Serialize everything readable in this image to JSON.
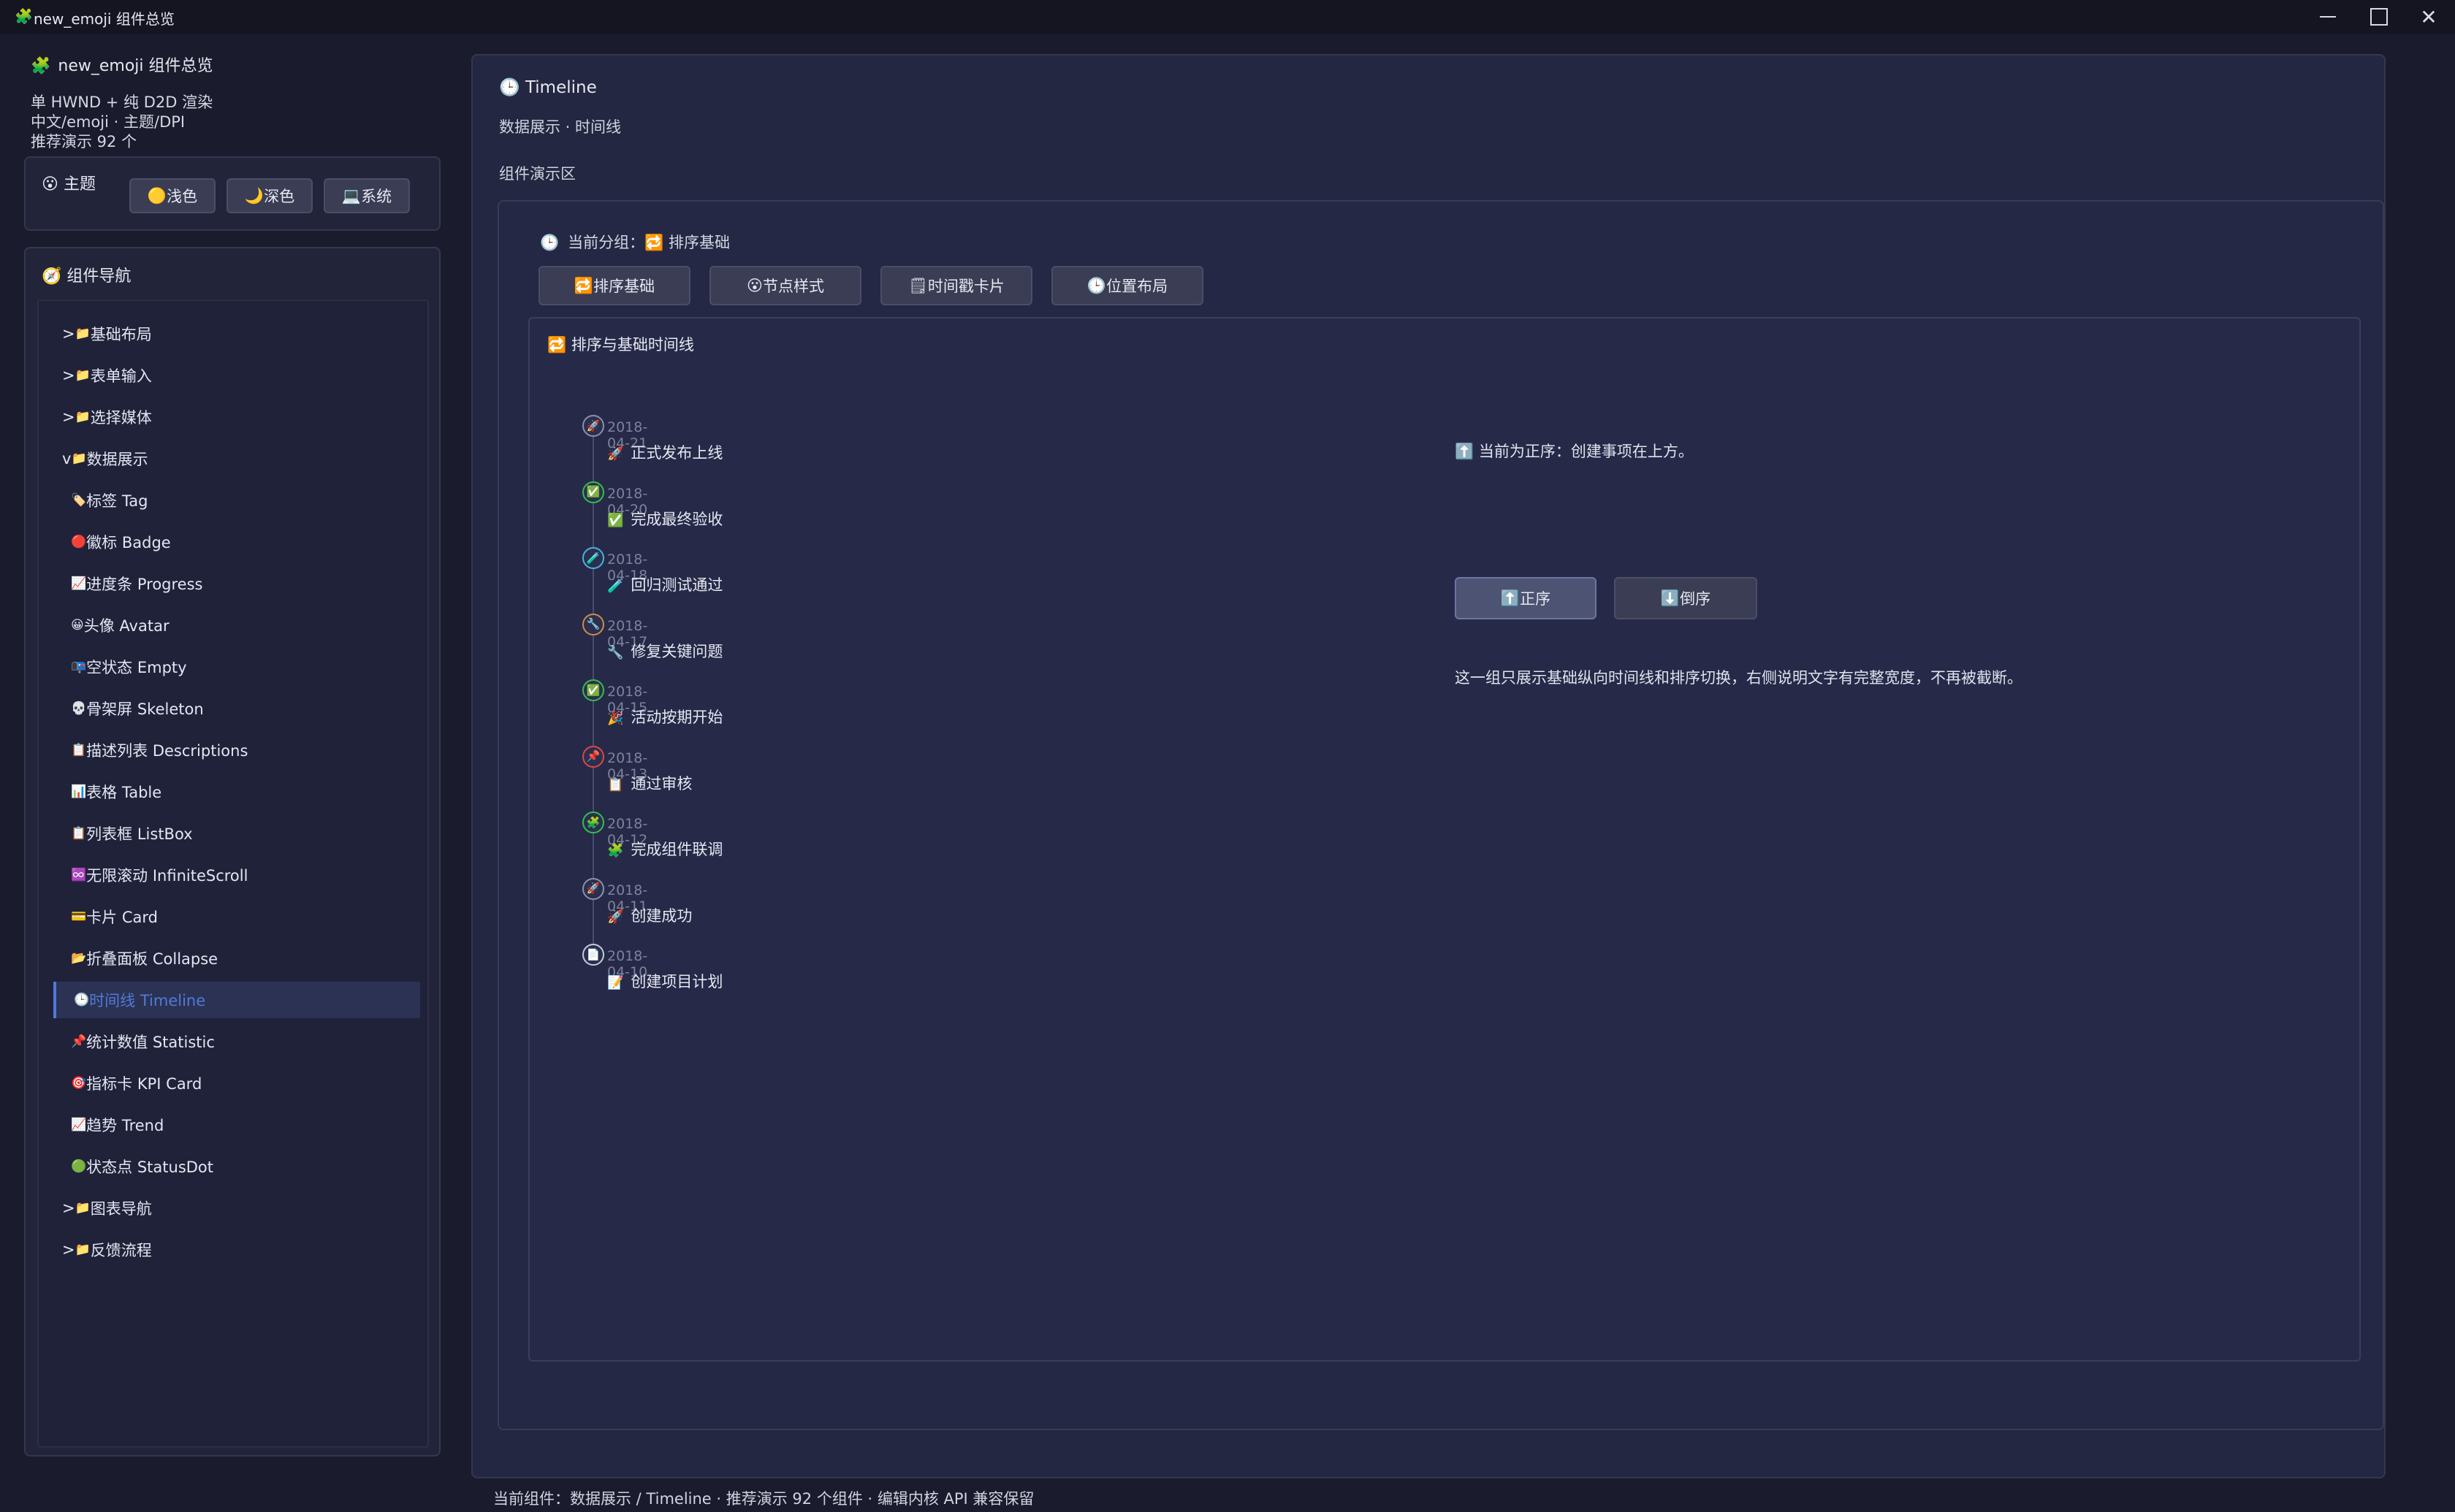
{
  "window": {
    "icon": "🧩",
    "title": "new_emoji 组件总览"
  },
  "sidebar": {
    "app_icon": "🧩",
    "app_title": "new_emoji 组件总览",
    "lines": [
      "单 HWND + 纯 D2D 渲染",
      "中文/emoji · 主题/DPI",
      "推荐演示 92 个"
    ],
    "theme": {
      "icon": "😮",
      "title": "主题",
      "buttons": [
        {
          "icon": "🟡",
          "label": "浅色"
        },
        {
          "icon": "🌙",
          "label": "深色"
        },
        {
          "icon": "💻",
          "label": "系统"
        }
      ]
    },
    "nav": {
      "icon": "🧭",
      "title": "组件导航",
      "items": [
        {
          "prefix": ">",
          "icon": "📁",
          "label": "基础布局",
          "child": false
        },
        {
          "prefix": ">",
          "icon": "📁",
          "label": "表单输入",
          "child": false
        },
        {
          "prefix": ">",
          "icon": "📁",
          "label": "选择媒体",
          "child": false
        },
        {
          "prefix": "v",
          "icon": "📁",
          "label": "数据展示",
          "child": false
        },
        {
          "prefix": "",
          "icon": "🏷️",
          "label": "标签 Tag",
          "child": true
        },
        {
          "prefix": "",
          "icon": "🔴",
          "label": "徽标 Badge",
          "child": true
        },
        {
          "prefix": "",
          "icon": "📈",
          "label": "进度条 Progress",
          "child": true
        },
        {
          "prefix": "",
          "icon": "😀",
          "label": "头像 Avatar",
          "child": true
        },
        {
          "prefix": "",
          "icon": "📭",
          "label": "空状态 Empty",
          "child": true
        },
        {
          "prefix": "",
          "icon": "💀",
          "label": "骨架屏 Skeleton",
          "child": true
        },
        {
          "prefix": "",
          "icon": "📋",
          "label": "描述列表 Descriptions",
          "child": true
        },
        {
          "prefix": "",
          "icon": "📊",
          "label": "表格 Table",
          "child": true
        },
        {
          "prefix": "",
          "icon": "📋",
          "label": "列表框 ListBox",
          "child": true
        },
        {
          "prefix": "",
          "icon": "♾️",
          "label": "无限滚动 InfiniteScroll",
          "child": true
        },
        {
          "prefix": "",
          "icon": "💳",
          "label": "卡片 Card",
          "child": true
        },
        {
          "prefix": "",
          "icon": "📂",
          "label": "折叠面板 Collapse",
          "child": true
        },
        {
          "prefix": "",
          "icon": "🕒",
          "label": "时间线 Timeline",
          "child": true,
          "active": true
        },
        {
          "prefix": "",
          "icon": "📌",
          "label": "统计数值 Statistic",
          "child": true
        },
        {
          "prefix": "",
          "icon": "🎯",
          "label": "指标卡 KPI Card",
          "child": true
        },
        {
          "prefix": "",
          "icon": "📈",
          "label": "趋势 Trend",
          "child": true
        },
        {
          "prefix": "",
          "icon": "🟢",
          "label": "状态点 StatusDot",
          "child": true
        },
        {
          "prefix": ">",
          "icon": "📁",
          "label": "图表导航",
          "child": false
        },
        {
          "prefix": ">",
          "icon": "📁",
          "label": "反馈流程",
          "child": false
        }
      ]
    }
  },
  "main": {
    "title_icon": "🕒",
    "title": "Timeline",
    "subtitle": "数据展示 · 时间线",
    "area_label": "组件演示区",
    "group": {
      "icon": "🕒",
      "label": "当前分组：",
      "value_icon": "🔁",
      "value": "排序基础"
    },
    "tabs": [
      {
        "icon": "🔁",
        "label": "排序基础"
      },
      {
        "icon": "😮",
        "label": "节点样式"
      },
      {
        "icon": "🗒",
        "label": "时间戳卡片"
      },
      {
        "icon": "🕒",
        "label": "位置布局"
      }
    ],
    "panel": {
      "icon": "🔁",
      "title": "排序与基础时间线"
    },
    "timeline": [
      {
        "node": "🚀",
        "color": "#8b90b0",
        "date": "2018-04-21",
        "icon": "🚀",
        "text": "正式发布上线"
      },
      {
        "node": "✅",
        "color": "#2fbf4f",
        "date": "2018-04-20",
        "icon": "✅",
        "text": "完成最终验收"
      },
      {
        "node": "🧪",
        "color": "#4ab3d8",
        "date": "2018-04-18",
        "icon": "🧪",
        "text": "回归测试通过"
      },
      {
        "node": "🔧",
        "color": "#d08a4a",
        "date": "2018-04-17",
        "icon": "🔧",
        "text": "修复关键问题"
      },
      {
        "node": "✅",
        "color": "#2fbf4f",
        "date": "2018-04-15",
        "icon": "🎉",
        "text": "活动按期开始"
      },
      {
        "node": "📌",
        "color": "#d94848",
        "date": "2018-04-13",
        "icon": "📋",
        "text": "通过审核"
      },
      {
        "node": "🧩",
        "color": "#2fbf4f",
        "date": "2018-04-12",
        "icon": "🧩",
        "text": "完成组件联调"
      },
      {
        "node": "🚀",
        "color": "#8b90b0",
        "date": "2018-04-11",
        "icon": "🚀",
        "text": "创建成功"
      },
      {
        "node": "📄",
        "color": "#c8cad4",
        "date": "2018-04-10",
        "icon": "📝",
        "text": "创建项目计划"
      }
    ],
    "order_note_icon": "⬆️",
    "order_note": "当前为正序：创建事项在上方。",
    "order_buttons": [
      {
        "icon": "⬆️",
        "label": "正序",
        "selected": true
      },
      {
        "icon": "⬇️",
        "label": "倒序",
        "selected": false
      }
    ],
    "description": "这一组只展示基础纵向时间线和排序切换，右侧说明文字有完整宽度，不再被截断。"
  },
  "statusbar": "当前组件：数据展示 / Timeline · 推荐演示 92 个组件 · 编辑内核 API 兼容保留",
  "colors": {
    "accent": "#4f7bd6",
    "background": "#1a1b2c",
    "panel": "#242741"
  }
}
